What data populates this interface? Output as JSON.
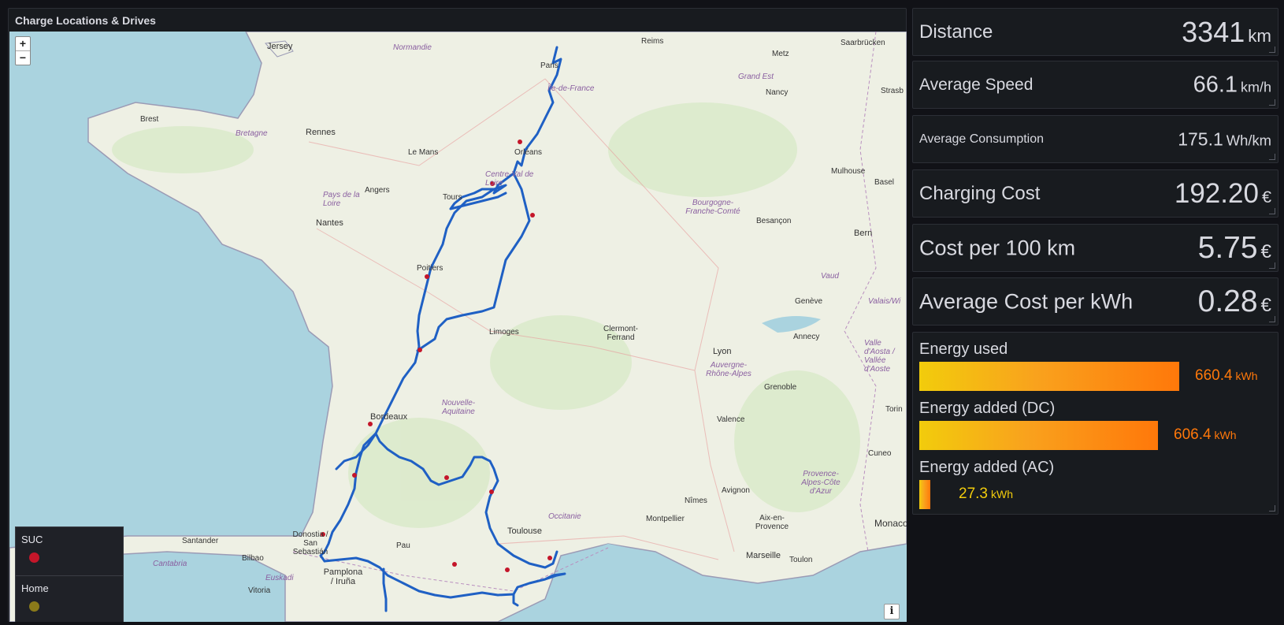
{
  "map_panel": {
    "title": "Charge Locations & Drives",
    "zoom_in": "+",
    "zoom_out": "−",
    "info": "i",
    "legend": [
      {
        "label": "SUC",
        "color": "#c4162a"
      },
      {
        "label": "Home",
        "color": "#8a7a1a"
      }
    ],
    "cities": [
      "Jersey",
      "Normandie",
      "Paris",
      "Reims",
      "Metz",
      "Saarbrücken",
      "Île-de-France",
      "Grand Est",
      "Nancy",
      "Strasb",
      "Brest",
      "Bretagne",
      "Rennes",
      "Le Mans",
      "Orléans",
      "Centre-Val de Loire",
      "Mulhouse",
      "Basel",
      "Angers",
      "Pays de la Loire",
      "Tours",
      "Bourgogne-Franche-Comté",
      "Besançon",
      "Bern",
      "Nantes",
      "Poitiers",
      "Vaud",
      "Genève",
      "Valais/Wi",
      "Limoges",
      "Clermont-Ferrand",
      "Lyon",
      "Annecy",
      "Valle d'Aosta / Vallée d'Aoste",
      "Auvergne-Rhône-Alpes",
      "Grenoble",
      "Bordeaux",
      "Nouvelle-Aquitaine",
      "Valence",
      "Torin",
      "Cuneo",
      "Provence-Alpes-Côte d'Azur",
      "Occitanie",
      "Avignon",
      "Nîmes",
      "Montpellier",
      "Aix-en-Provence",
      "Toulouse",
      "Monaco",
      "Marseille",
      "Toulon",
      "Santander",
      "Donostia / San Sebastián",
      "Bilbao",
      "Pau",
      "Cantabria",
      "Euskadi",
      "Pamplona / Iruña",
      "Vitoria"
    ]
  },
  "stats": {
    "distance": {
      "label": "Distance",
      "value": "3341",
      "unit": "km"
    },
    "avg_speed": {
      "label": "Average Speed",
      "value": "66.1",
      "unit": "km/h"
    },
    "avg_consumption": {
      "label": "Average Consumption",
      "value": "175.1",
      "unit": "Wh/km"
    },
    "charging_cost": {
      "label": "Charging Cost",
      "value": "192.20",
      "unit": "€"
    },
    "cost_per_100": {
      "label": "Cost per 100 km",
      "value": "5.75",
      "unit": "€"
    },
    "avg_cost_kwh": {
      "label": "Average Cost per kWh",
      "value": "0.28",
      "unit": "€"
    }
  },
  "energy": {
    "used": {
      "label": "Energy used",
      "value": "660.4",
      "unit": "kWh",
      "fraction": 1.0,
      "color": "#ff780a"
    },
    "added_dc": {
      "label": "Energy added (DC)",
      "value": "606.4",
      "unit": "kWh",
      "fraction": 0.918,
      "color": "#ff780a"
    },
    "added_ac": {
      "label": "Energy added (AC)",
      "value": "27.3",
      "unit": "kWh",
      "fraction": 0.041,
      "color": "#f2cc0c"
    }
  }
}
